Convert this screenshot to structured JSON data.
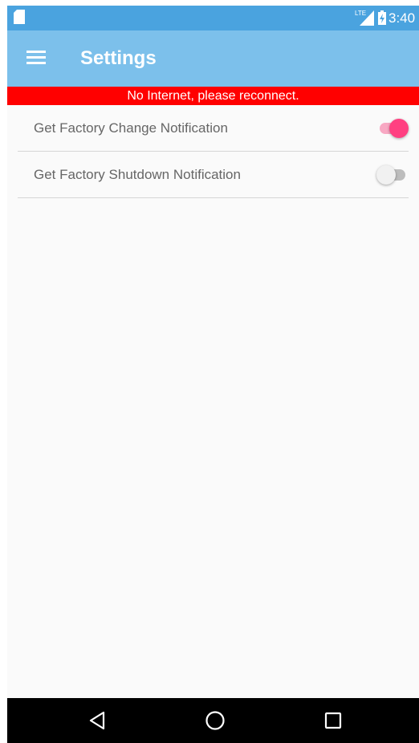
{
  "status_bar": {
    "network_label": "LTE",
    "time": "3:40",
    "icons": [
      "sd-card-icon",
      "lte-signal-icon",
      "battery-charging-icon"
    ]
  },
  "app_bar": {
    "title": "Settings",
    "menu_icon": "menu-icon"
  },
  "banner": {
    "message": "No Internet, please reconnect.",
    "color": "#ff0000"
  },
  "settings": [
    {
      "label": "Get Factory Change Notification",
      "enabled": true
    },
    {
      "label": "Get Factory Shutdown Notification",
      "enabled": false
    }
  ],
  "nav_bar": {
    "icons": [
      "back-icon",
      "home-icon",
      "recents-icon"
    ]
  },
  "colors": {
    "status_bar": "#4aa3df",
    "app_bar": "#7cc0eb",
    "switch_on": "#ff4081",
    "background": "#fafafa"
  }
}
